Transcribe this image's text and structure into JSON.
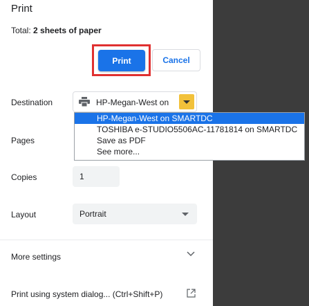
{
  "header": {
    "title": "Print",
    "total_prefix": "Total: ",
    "total_value": "2 sheets of paper"
  },
  "actions": {
    "print_label": "Print",
    "cancel_label": "Cancel"
  },
  "destination": {
    "label": "Destination",
    "selected": "HP-Megan-West on",
    "icon": "printer-icon",
    "options": [
      "HP-Megan-West on SMARTDC",
      "TOSHIBA e-STUDIO5506AC-11781814 on SMARTDC",
      "Save as PDF",
      "See more..."
    ]
  },
  "pages": {
    "label": "Pages"
  },
  "copies": {
    "label": "Copies",
    "value": "1"
  },
  "layout": {
    "label": "Layout",
    "value": "Portrait"
  },
  "more_settings": {
    "label": "More settings",
    "icon": "chevron-down-icon"
  },
  "system_dialog": {
    "label": "Print using system dialog... (Ctrl+Shift+P)",
    "icon": "open-external-icon"
  },
  "colors": {
    "accent": "#1a73e8",
    "highlight_border": "#e03030",
    "dropdown_arrow_bg": "#f2c13a",
    "side_strip": "#3c3c3c"
  }
}
